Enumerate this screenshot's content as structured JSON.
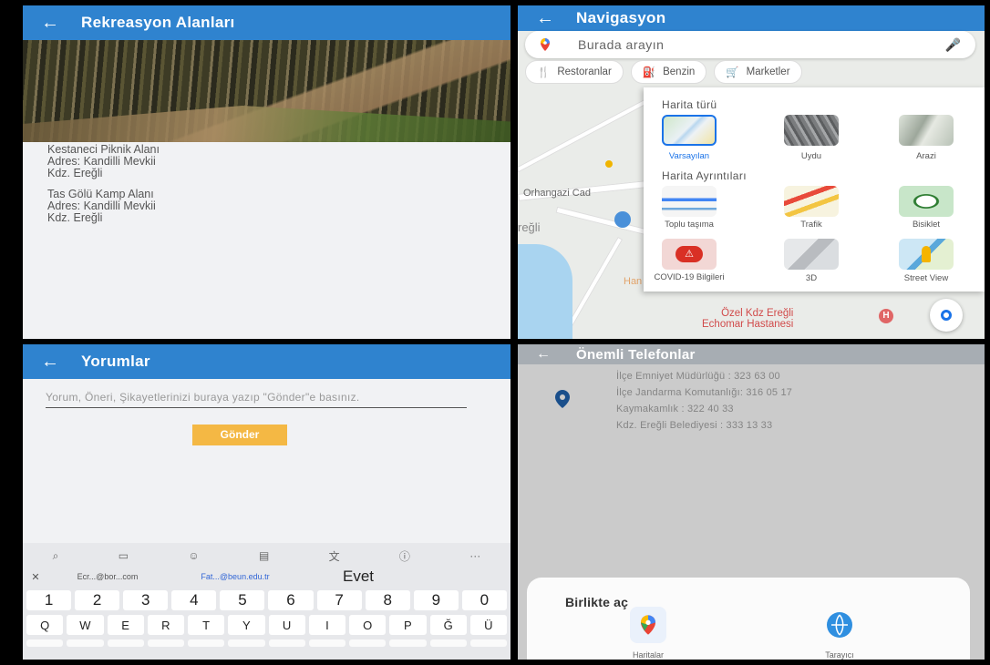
{
  "panel1": {
    "title": "Rekreasyon Alanları",
    "items": [
      {
        "name": "Kestaneci Piknik Alanı",
        "address": "Adres: Kandilli Mevkii",
        "city": "Kdz. Ereğli"
      },
      {
        "name": "Tas Gölü Kamp Alanı",
        "address": "Adres: Kandilli Mevkii",
        "city": "Kdz. Ereğli"
      }
    ]
  },
  "panel2": {
    "title": "Navigasyon",
    "search_placeholder": "Burada arayın",
    "chips": [
      "Restoranlar",
      "Benzin",
      "Marketler"
    ],
    "map_labels": {
      "street": "Orhangazi Cad",
      "town": "reğli",
      "hospital_line1": "Özel Kdz Ereğli",
      "hospital_line2": "Echomar Hastanesi",
      "partial": "Han"
    },
    "map_type_heading": "Harita türü",
    "map_types": [
      "Varsayılan",
      "Uydu",
      "Arazi"
    ],
    "map_details_heading": "Harita Ayrıntıları",
    "map_details": [
      "Toplu taşıma",
      "Trafik",
      "Bisiklet",
      "COVID-19 Bilgileri",
      "3D",
      "Street View"
    ],
    "colors": {
      "accent": "#1a73e8",
      "appbar": "#2f83cf"
    }
  },
  "panel3": {
    "title": "Yorumlar",
    "comment_placeholder": "Yorum, Öneri, Şikayetlerinizi buraya yazıp \"Gönder\"e basınız.",
    "send_label": "Gönder",
    "suggestions": [
      "Ecr...@bor...com",
      "Fat...@beun.edu.tr",
      "Evet"
    ],
    "number_row": [
      "1",
      "2",
      "3",
      "4",
      "5",
      "6",
      "7",
      "8",
      "9",
      "0"
    ],
    "letter_row": [
      "Q",
      "W",
      "E",
      "R",
      "T",
      "Y",
      "U",
      "I",
      "O",
      "P",
      "Ğ",
      "Ü"
    ],
    "colors": {
      "send_button": "#f4b844"
    }
  },
  "panel4": {
    "title": "Önemli Telefonlar",
    "phones": [
      "İlçe Emniyet Müdürlüğü : 323 63 00",
      "İlçe Jandarma Komutanlığı: 316 05 17",
      "Kaymakamlık : 322 40 33",
      "Kdz. Ereğli Belediyesi : 333 13 33"
    ],
    "open_with_title": "Birlikte aç",
    "apps": [
      "Haritalar",
      "Tarayıcı"
    ]
  }
}
